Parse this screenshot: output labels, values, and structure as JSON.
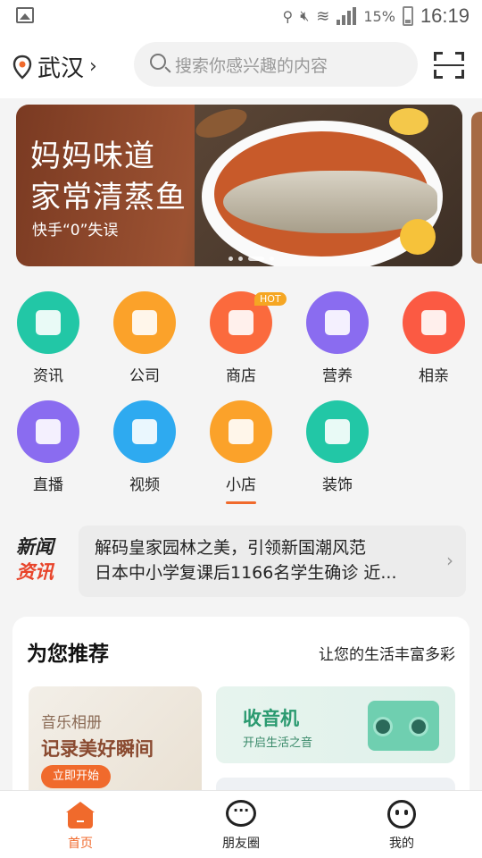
{
  "status": {
    "battery": "15%",
    "time": "16:19"
  },
  "header": {
    "city": "武汉",
    "search_placeholder": "搜索你感兴趣的内容"
  },
  "banner": {
    "title_line1": "妈妈味道",
    "title_line2": "家常清蒸鱼",
    "subtitle": "快手“0”失误"
  },
  "categories": [
    {
      "label": "资讯",
      "icon": "news-doc-icon",
      "color": "#22c7a6"
    },
    {
      "label": "公司",
      "icon": "building-icon",
      "color": "#fba22a"
    },
    {
      "label": "商店",
      "icon": "store-icon",
      "color": "#fb6a3d",
      "badge": "HOT"
    },
    {
      "label": "营养",
      "icon": "nutrition-jar-icon",
      "color": "#8a6cf0"
    },
    {
      "label": "相亲",
      "icon": "heart-icon",
      "color": "#fb5a43"
    },
    {
      "label": "直播",
      "icon": "video-camera-icon",
      "color": "#8a6cf0"
    },
    {
      "label": "视频",
      "icon": "tv-play-icon",
      "color": "#2eaaf0"
    },
    {
      "label": "小店",
      "icon": "cart-icon",
      "color": "#fba22a"
    },
    {
      "label": "装饰",
      "icon": "paint-brush-icon",
      "color": "#22c7a6"
    }
  ],
  "news": {
    "logo_line1": "新闻",
    "logo_line2": "资讯",
    "items": [
      "解码皇家园林之美，引领新国潮风范",
      "日本中小学复课后1166名学生确诊 近..."
    ]
  },
  "recommend": {
    "title": "为您推荐",
    "subtitle": "让您的生活丰富多彩",
    "card_album": {
      "tag": "音乐相册",
      "headline": "记录美好瞬间",
      "button": "立即开始"
    },
    "card_radio": {
      "headline": "收音机",
      "sub": "开启生活之音"
    }
  },
  "bottom_nav": [
    {
      "label": "首页",
      "icon": "home-icon",
      "active": true
    },
    {
      "label": "朋友圈",
      "icon": "chat-bubble-icon",
      "active": false
    },
    {
      "label": "我的",
      "icon": "profile-face-icon",
      "active": false
    }
  ],
  "colors": {
    "accent": "#f06a2c",
    "active_tab": "#f06a2c"
  }
}
